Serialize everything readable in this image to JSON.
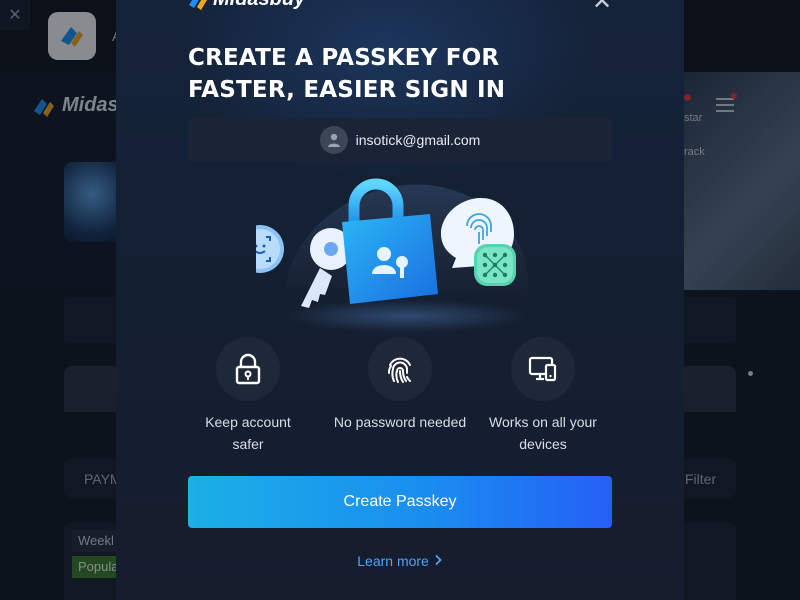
{
  "background": {
    "close_glyph": "✕",
    "app_letter": "A",
    "logo_text": "Midasb",
    "banner_text_1": "star",
    "banner_text_2": "rack",
    "payment_label": "PAYM",
    "filter_label": "Filter",
    "tag_weekly": "Weekl",
    "tag_popular": "Popula"
  },
  "modal": {
    "logo_text": "Midasbuy",
    "close_glyph": "✕",
    "title": "CREATE A PASSKEY FOR FASTER, EASIER SIGN IN",
    "email": "insotick@gmail.com",
    "features": [
      {
        "label": "Keep account safer",
        "icon": "lock-icon"
      },
      {
        "label": "No password needed",
        "icon": "fingerprint-icon"
      },
      {
        "label": "Works on all your devices",
        "icon": "devices-icon"
      }
    ],
    "cta_label": "Create Passkey",
    "learn_more": "Learn more"
  },
  "colors": {
    "accent_blue": "#1a8ef0",
    "link_blue": "#4fa3ff",
    "modal_bg": "#142033",
    "page_bg": "#121a26"
  }
}
